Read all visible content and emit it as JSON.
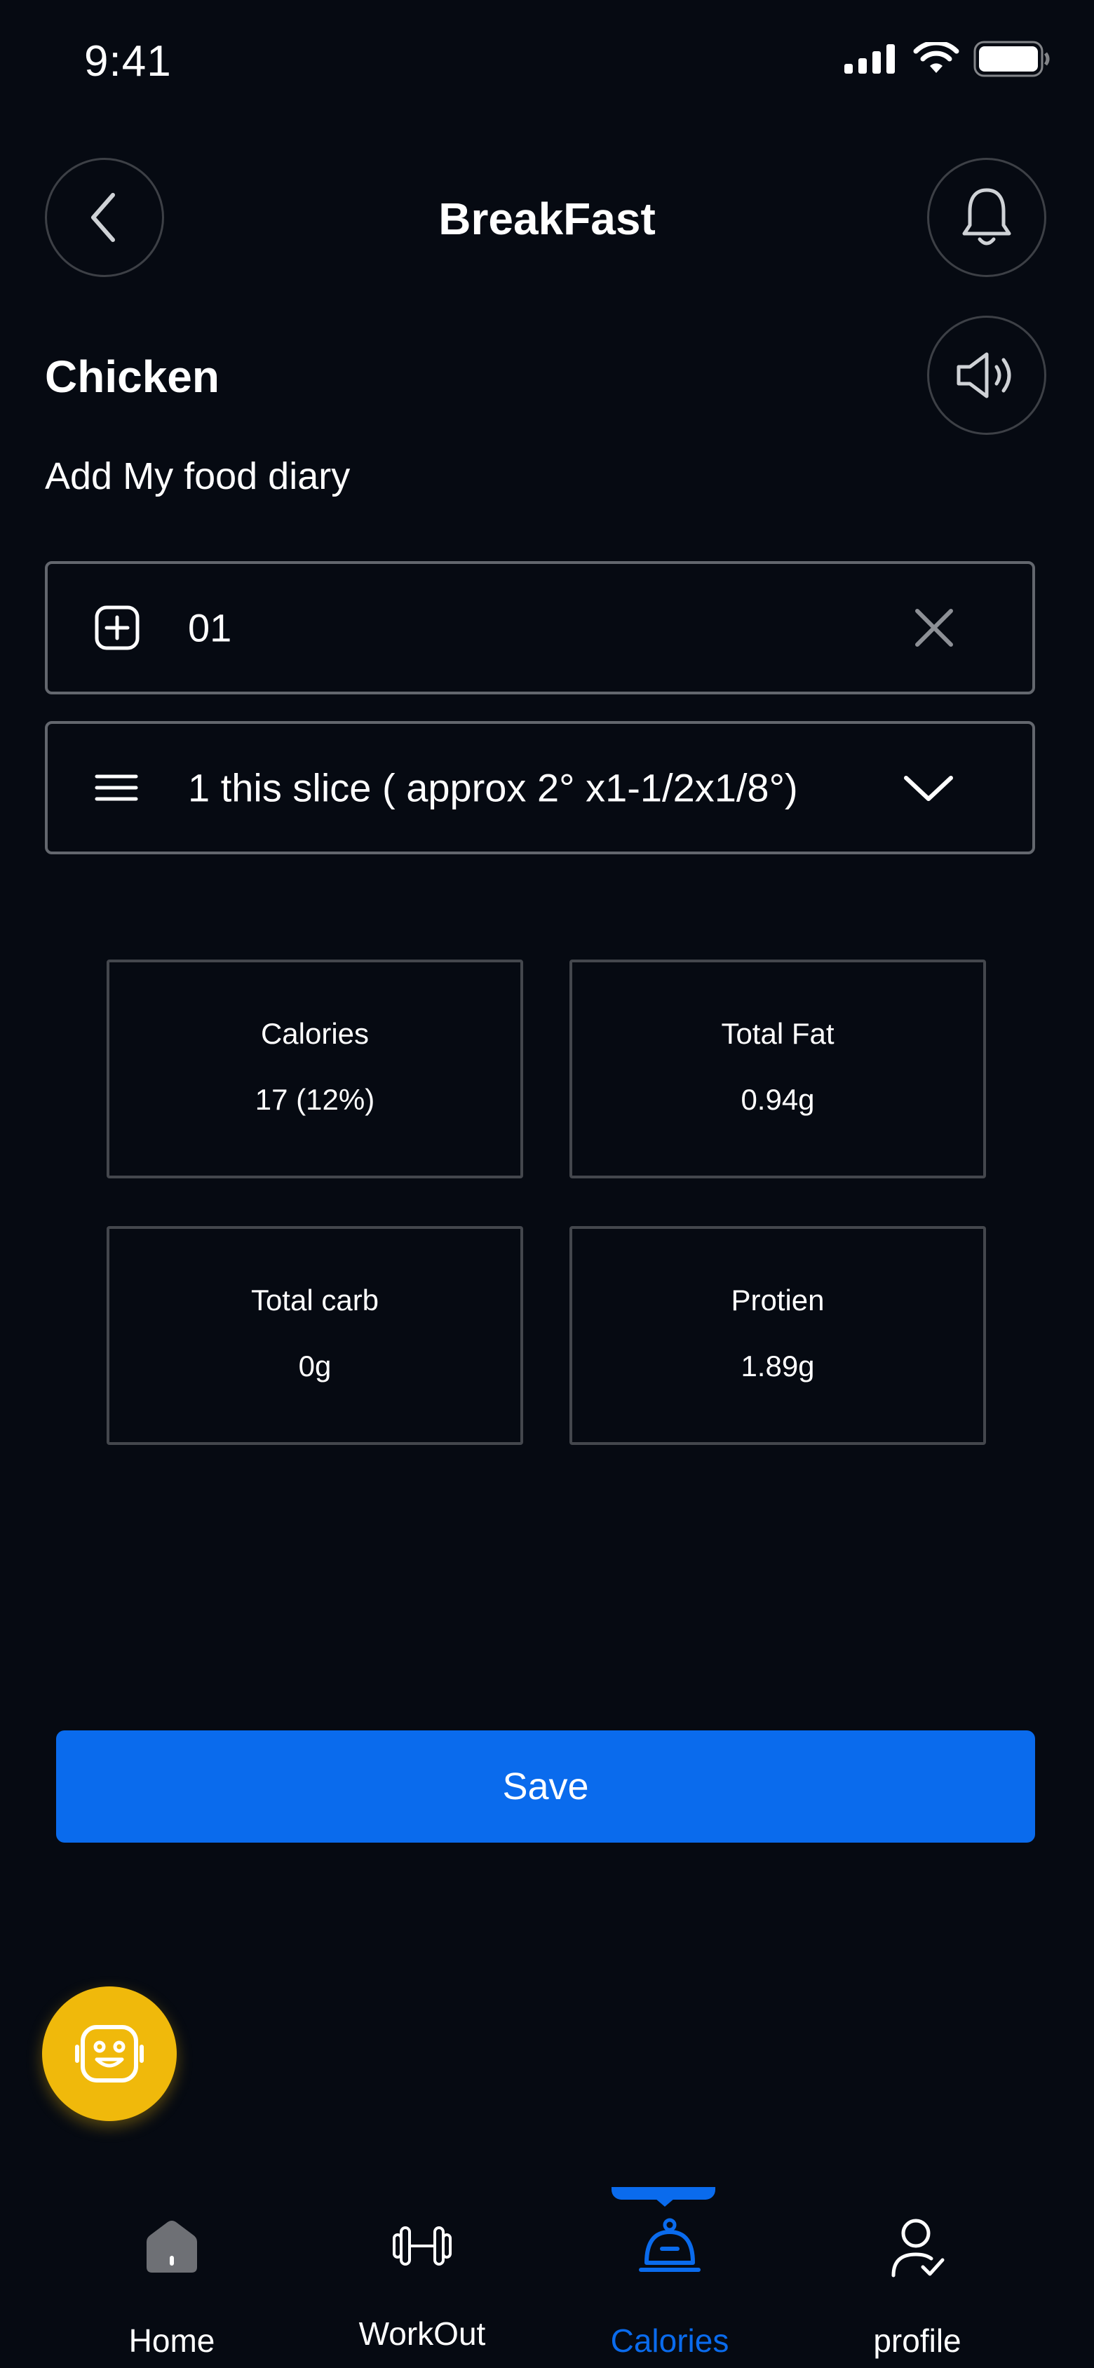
{
  "status_bar": {
    "time": "9:41"
  },
  "header": {
    "title": "BreakFast"
  },
  "food": {
    "name": "Chicken",
    "subtitle": "Add My food diary"
  },
  "quantity_field": {
    "value": "01"
  },
  "serving_select": {
    "value": "1 this slice ( approx 2° x1-1/2x1/8°)"
  },
  "nutrition": [
    {
      "label": "Calories",
      "value": "17 (12%)"
    },
    {
      "label": "Total Fat",
      "value": "0.94g"
    },
    {
      "label": "Total carb",
      "value": "0g"
    },
    {
      "label": "Protien",
      "value": "1.89g"
    }
  ],
  "save_label": "Save",
  "nav": {
    "items": [
      {
        "label": "Home",
        "icon": "home-icon"
      },
      {
        "label": "WorkOut",
        "icon": "dumbbell-icon"
      },
      {
        "label": "Calories",
        "icon": "food-cloche-icon"
      },
      {
        "label": "profile",
        "icon": "profile-icon"
      }
    ],
    "active": "Calories"
  },
  "colors": {
    "background": "#060a12",
    "accent": "#0a6bed",
    "assistant": "#f0b90b",
    "border": "#63676e"
  }
}
